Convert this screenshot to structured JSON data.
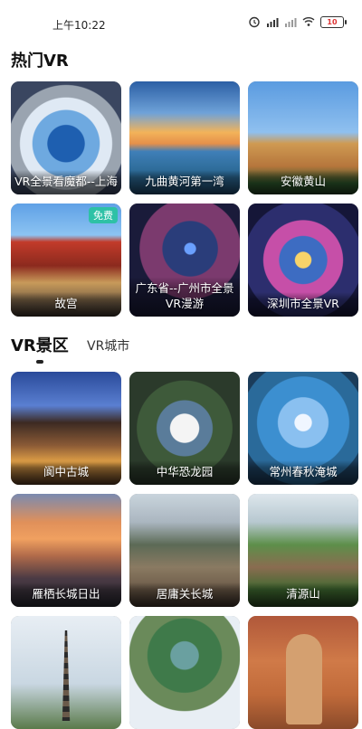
{
  "status_bar": {
    "time": "上午10:22",
    "battery": "10"
  },
  "hot_section": {
    "title": "热门VR",
    "cards": [
      {
        "label": "VR全景看魔都--上海",
        "image": "shanghai-panorama"
      },
      {
        "label": "九曲黄河第一湾",
        "image": "yellow-river-bend"
      },
      {
        "label": "安徽黄山",
        "image": "huangshan-tower"
      },
      {
        "label": "故宫",
        "image": "forbidden-city",
        "badge": "免费"
      },
      {
        "label": "广东省--广州市全景VR漫游",
        "image": "guangzhou-tower"
      },
      {
        "label": "深圳市全景VR",
        "image": "shenzhen-panorama"
      }
    ]
  },
  "tabs": {
    "active": "VR景区",
    "inactive": "VR城市"
  },
  "scenic_section": {
    "cards": [
      {
        "label": "阆中古城",
        "image": "langzhong-ancient-city"
      },
      {
        "label": "中华恐龙园",
        "image": "dinosaur-park"
      },
      {
        "label": "常州春秋淹城",
        "image": "chunqiu-yancheng"
      },
      {
        "label": "雁栖长城日出",
        "image": "yanqi-great-wall-sunrise"
      },
      {
        "label": "居庸关长城",
        "image": "juyongguan-great-wall"
      },
      {
        "label": "清源山",
        "image": "qingyuan-mountain"
      },
      {
        "label": "",
        "image": "pagoda"
      },
      {
        "label": "",
        "image": "lake-panorama"
      },
      {
        "label": "",
        "image": "buddha-statue"
      }
    ]
  }
}
